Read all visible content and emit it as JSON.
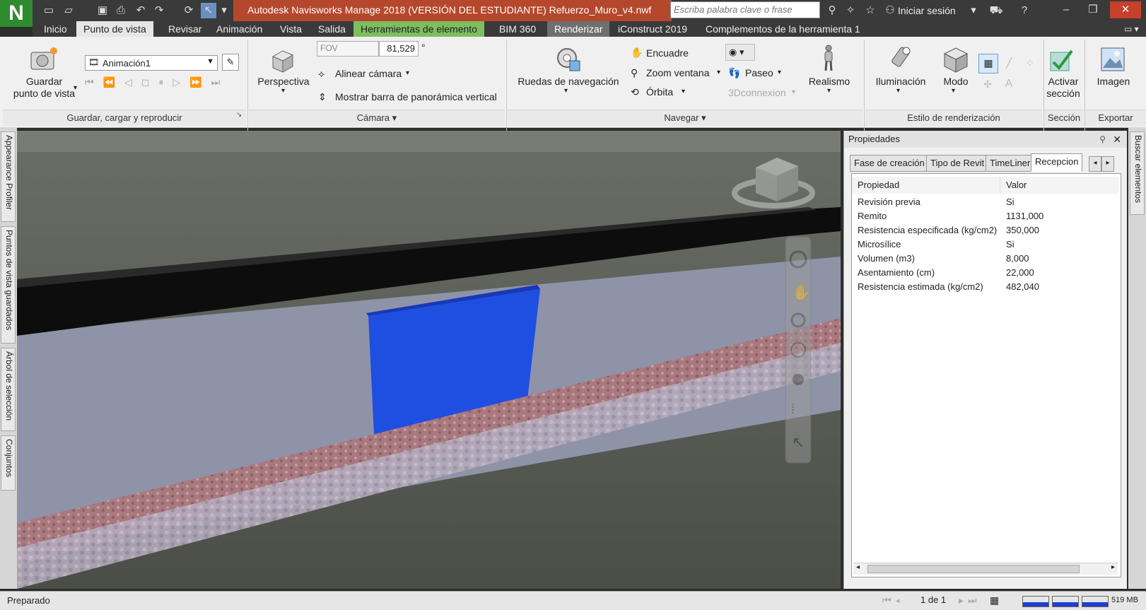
{
  "window": {
    "title": "Autodesk Navisworks Manage 2018 (VERSIÓN DEL ESTUDIANTE)    Refuerzo_Muro_v4.nwf",
    "search_placeholder": "Escriba palabra clave o frase",
    "signin": "Iniciar sesión"
  },
  "tabs": [
    "Inicio",
    "Punto de vista",
    "Revisar",
    "Animación",
    "Vista",
    "Salida",
    "Herramientas de elemento",
    "BIM 360",
    "Renderizar",
    "iConstruct 2019",
    "Complementos de la herramienta 1"
  ],
  "ribbon": {
    "save": {
      "line1": "Guardar",
      "line2": "punto de vista"
    },
    "animation_select": "Animación1",
    "panel_save": "Guardar, cargar y reproducir",
    "perspective": "Perspectiva",
    "fov_label": "FOV",
    "fov_value": "81,529",
    "fov_unit": "°",
    "align_camera": "Alinear cámara",
    "vertical_bar": "Mostrar barra de panorámica vertical",
    "panel_camera": "Cámara",
    "nav_wheels": "Ruedas de navegación",
    "pan": "Encuadre",
    "zoom_window": "Zoom ventana",
    "orbit": "Órbita",
    "walk": "Paseo",
    "connexion": "3Dconnexion",
    "realism": "Realismo",
    "panel_navigate": "Navegar",
    "lighting": "Iluminación",
    "mode": "Modo",
    "panel_render": "Estilo de renderización",
    "activate_section": {
      "line1": "Activar",
      "line2": "sección"
    },
    "panel_section": "Sección",
    "image": "Imagen",
    "panel_export": "Exportar"
  },
  "left_dock": [
    "Appearance Profiler",
    "Puntos de vista guardados",
    "Árbol de selección",
    "Conjuntos"
  ],
  "right_dock": [
    "Buscar elementos"
  ],
  "properties": {
    "title": "Propiedades",
    "tabs": [
      "Fase de creación",
      "Tipo de Revit",
      "TimeLiner",
      "Recepcion"
    ],
    "headers": [
      "Propiedad",
      "Valor"
    ],
    "rows": [
      {
        "name": "Revisión previa",
        "value": "Si"
      },
      {
        "name": "Remito",
        "value": "1131,000"
      },
      {
        "name": "Resistencia especificada (kg/cm2)",
        "value": "350,000"
      },
      {
        "name": "Microsílice",
        "value": "Si"
      },
      {
        "name": "Volumen (m3)",
        "value": "8,000"
      },
      {
        "name": "Asentamiento (cm)",
        "value": "22,000"
      },
      {
        "name": "Resistencia estimada (kg/cm2)",
        "value": "482,040"
      }
    ]
  },
  "status": {
    "text": "Preparado",
    "page": "1 de 1",
    "memory": "519 MB"
  },
  "colors": {
    "highlight": "#1f4fe0",
    "title_accent": "#b5482c",
    "logo": "#2e8b2e"
  }
}
